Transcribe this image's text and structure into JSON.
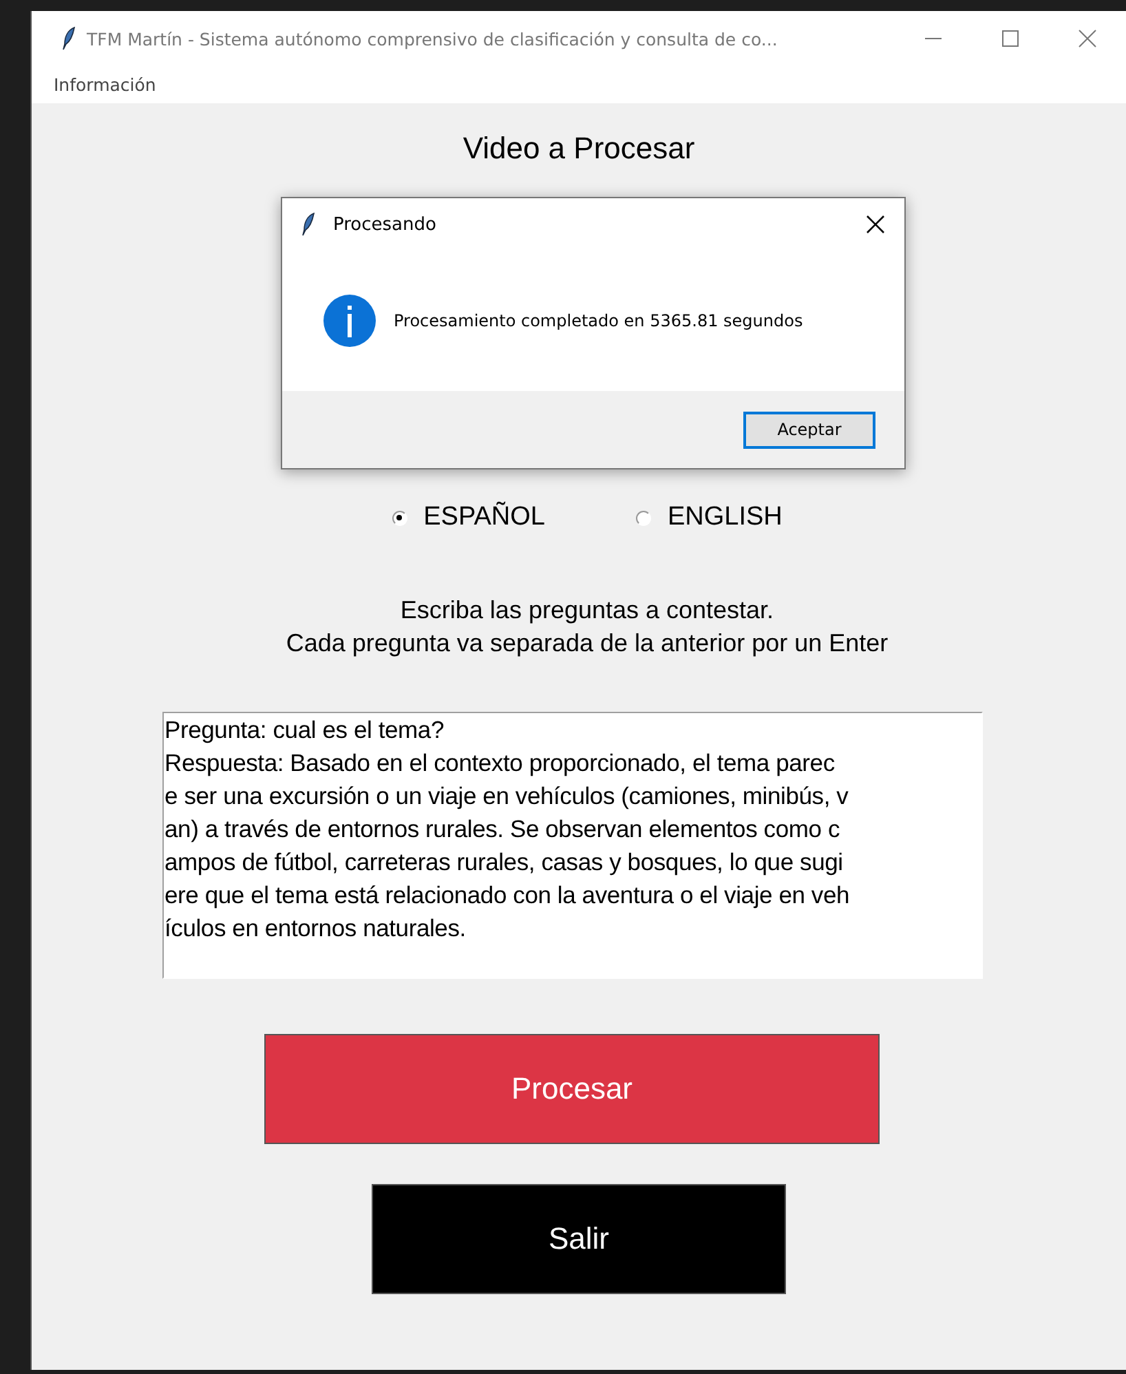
{
  "window": {
    "title": "TFM Martín - Sistema autónomo comprensivo de clasificación y consulta de co..."
  },
  "menu": [
    "Información"
  ],
  "heading": "Video a Procesar",
  "languages": [
    {
      "label": "ESPAÑOL",
      "selected": true
    },
    {
      "label": "ENGLISH",
      "selected": false
    }
  ],
  "instructions": "Escriba las preguntas a contestar.\nCada pregunta va separada de la anterior por un Enter",
  "answer_box": {
    "value": "Pregunta: cual es el tema?\nRespuesta: Basado en el contexto proporcionado, el tema parec\ne ser una excursión o un viaje en vehículos (camiones, minibús, v\nan) a través de entornos rurales. Se observan elementos como c\nampos de fútbol, carreteras rurales, casas y bosques, lo que sugi\nere que el tema está relacionado con la aventura o el viaje en veh\nículos en entornos naturales."
  },
  "buttons": [
    {
      "label": "Procesar",
      "kind": "primary"
    },
    {
      "label": "Salir",
      "kind": "exit"
    }
  ],
  "dialog": {
    "title": "Procesando",
    "message": "Procesamiento completado en 5365.81 segundos",
    "button": "Aceptar"
  }
}
